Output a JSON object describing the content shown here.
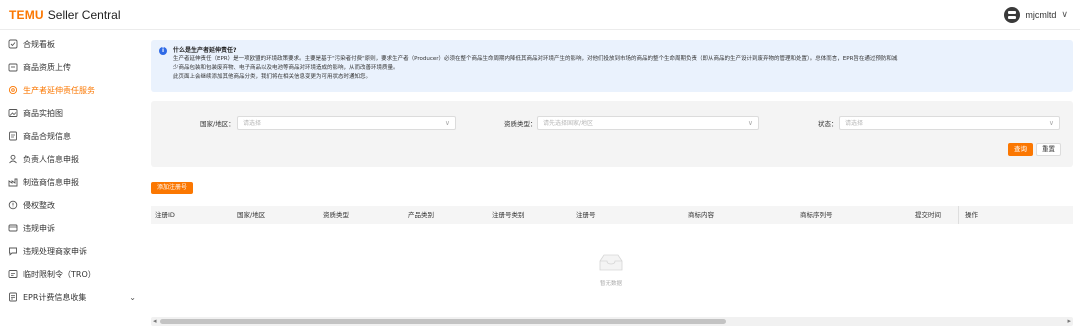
{
  "header": {
    "brand": "TEMU",
    "product": "Seller Central",
    "username": "mjcmltd",
    "user_menu_icon": "chevron-down-icon"
  },
  "sidebar": {
    "items": [
      {
        "label": "合规看板",
        "icon": "checkbox-icon",
        "active": false
      },
      {
        "label": "商品资质上传",
        "icon": "upload-icon",
        "active": false
      },
      {
        "label": "生产者延伸责任服务",
        "icon": "gear-icon",
        "active": true
      },
      {
        "label": "商品实拍图",
        "icon": "image-icon",
        "active": false
      },
      {
        "label": "商品合规信息",
        "icon": "document-icon",
        "active": false
      },
      {
        "label": "负责人信息申报",
        "icon": "person-icon",
        "active": false
      },
      {
        "label": "制造商信息申报",
        "icon": "factory-icon",
        "active": false
      },
      {
        "label": "侵权整改",
        "icon": "alert-icon",
        "active": false
      },
      {
        "label": "违规申诉",
        "icon": "appeal-icon",
        "active": false
      },
      {
        "label": "违规处理商家申诉",
        "icon": "message-icon",
        "active": false
      },
      {
        "label": "临时限制令（TRO）",
        "icon": "order-icon",
        "active": false
      },
      {
        "label": "EPR计费信息收集",
        "icon": "billing-icon",
        "active": false
      }
    ]
  },
  "notice": {
    "title": "什么是生产者延伸责任?",
    "lines": [
      "生产者延伸责任（EPR）是一项欧盟的环境政策要求。主要是基于\"污染者付费\"原则，要求生产者（Producer）必须在整个商品生命周期内降低其商品对环境产生的影响，对他们投放到市场的商品的整个生命周期负责（即从商品的生产设计到废弃物的管理和处置）。总体而言，EPR旨在通过预防和减",
      "少商品包装和包装废弃物、电子商品以及电池等商品对环境造成的影响，从而改善环境质量。",
      "此页面上会继续添加其他商品分类，我们将在相关信息变更为可用状态时通知您。"
    ]
  },
  "filters": {
    "country_label": "国家/地区：",
    "country_placeholder": "请选择",
    "qualification_label": "资质类型：",
    "qualification_placeholder": "请先选择国家/地区",
    "status_label": "状态：",
    "status_placeholder": "请选择",
    "query_button": "查询",
    "reset_button": "重置"
  },
  "actions": {
    "add_registration": "添加注册号"
  },
  "table": {
    "columns": [
      "注册ID",
      "国家/地区",
      "资质类型",
      "产品类别",
      "注册号类别",
      "注册号",
      "商标内容",
      "商标序列号",
      "提交时间",
      "操作"
    ],
    "rows": [],
    "empty_text": "暂无数据"
  },
  "scrollbar": {
    "left_arrow": "◂",
    "right_arrow": "▸"
  },
  "colors": {
    "brand_orange": "#fb7701",
    "notice_bg": "#eaf2fd",
    "info_blue": "#2f6ae6"
  }
}
